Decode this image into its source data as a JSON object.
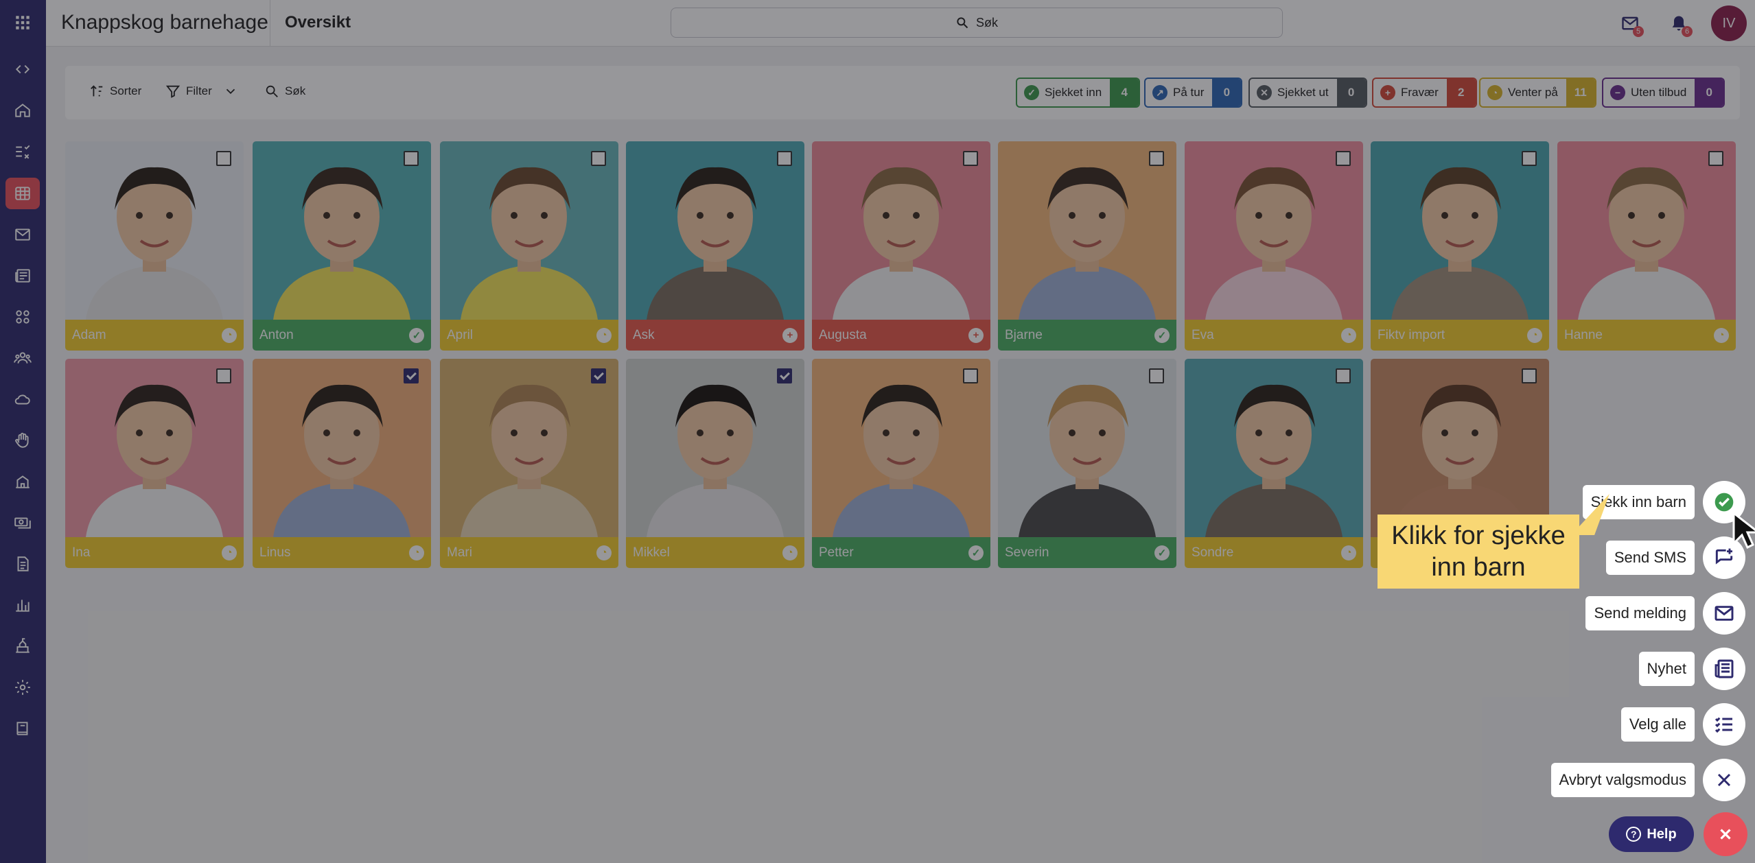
{
  "app": {
    "title": "Knappskog barnehage",
    "page_title": "Oversikt"
  },
  "search": {
    "label": "Søk"
  },
  "notifications": {
    "messages_count": "5",
    "alerts_count": "6"
  },
  "user": {
    "initials": "IV"
  },
  "toolbar": {
    "sort_label": "Sorter",
    "filter_label": "Filter",
    "search_label": "Søk"
  },
  "status_pills": [
    {
      "label": "Sjekket inn",
      "count": "4",
      "color": "#3c9a4e"
    },
    {
      "label": "På tur",
      "count": "0",
      "color": "#2c67b5"
    },
    {
      "label": "Sjekket ut",
      "count": "0",
      "color": "#555b62"
    },
    {
      "label": "Fravær",
      "count": "2",
      "color": "#d44a3a"
    },
    {
      "label": "Venter på",
      "count": "11",
      "color": "#d9b52a"
    },
    {
      "label": "Uten tilbud",
      "count": "0",
      "color": "#6a2f8e"
    }
  ],
  "children": [
    {
      "name": "Adam",
      "status": "waiting",
      "checked": false
    },
    {
      "name": "Anton",
      "status": "checked-in",
      "checked": false
    },
    {
      "name": "April",
      "status": "waiting",
      "checked": false
    },
    {
      "name": "Ask",
      "status": "absent",
      "checked": false
    },
    {
      "name": "Augusta",
      "status": "absent",
      "checked": false
    },
    {
      "name": "Bjarne",
      "status": "checked-in",
      "checked": false
    },
    {
      "name": "Eva",
      "status": "waiting",
      "checked": false
    },
    {
      "name": "Fiktv import",
      "status": "waiting",
      "checked": false
    },
    {
      "name": "Hanne",
      "status": "waiting",
      "checked": false
    },
    {
      "name": "Ina",
      "status": "waiting",
      "checked": false
    },
    {
      "name": "Linus",
      "status": "waiting",
      "checked": true
    },
    {
      "name": "Mari",
      "status": "waiting",
      "checked": true
    },
    {
      "name": "Mikkel",
      "status": "waiting",
      "checked": true
    },
    {
      "name": "Petter",
      "status": "checked-in",
      "checked": false
    },
    {
      "name": "Severin",
      "status": "checked-in",
      "checked": false
    },
    {
      "name": "Sondre",
      "status": "waiting",
      "checked": false
    },
    {
      "name": "",
      "status": "waiting",
      "checked": false
    }
  ],
  "speed_dial": {
    "check_in": "Sjekk inn barn",
    "send_sms": "Send SMS",
    "send_message": "Send melding",
    "news": "Nyhet",
    "select_all": "Velg alle",
    "cancel_select": "Avbryt valgsmodus"
  },
  "callout": {
    "line1": "Klikk for sjekke",
    "line2": "inn barn"
  },
  "help": {
    "label": "Help"
  }
}
